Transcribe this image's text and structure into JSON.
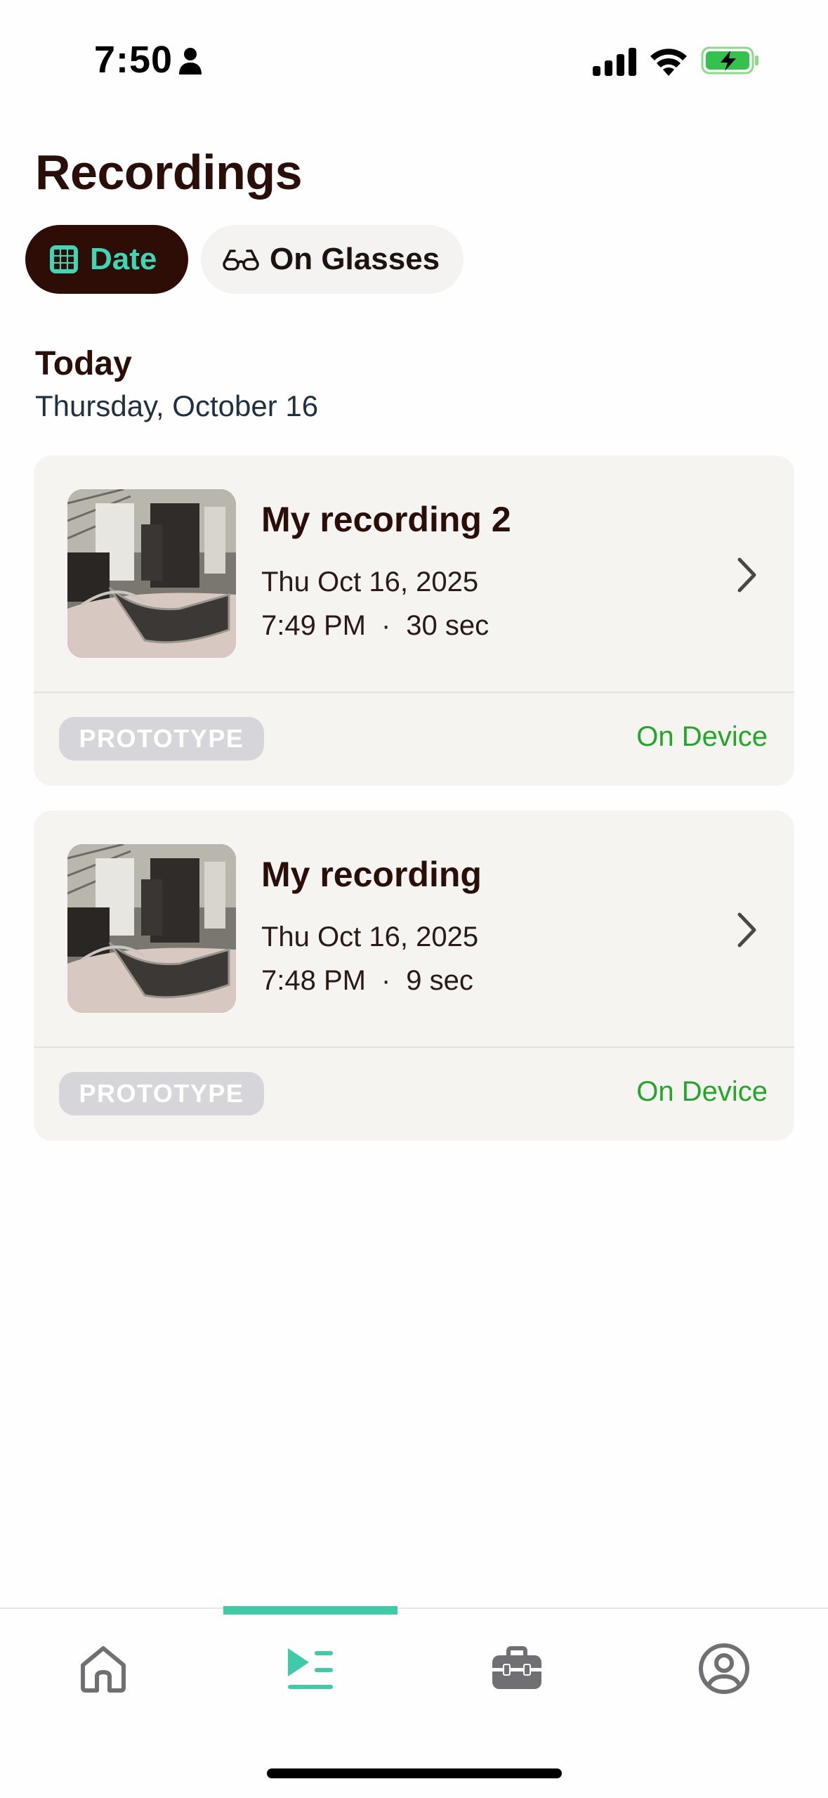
{
  "status_bar": {
    "time": "7:50",
    "icons": [
      "person-icon",
      "cellular-signal-icon",
      "wifi-icon",
      "battery-charging-icon"
    ]
  },
  "page": {
    "title": "Recordings"
  },
  "filters": [
    {
      "label": "Date",
      "icon": "calendar-grid-icon",
      "selected": true
    },
    {
      "label": "On Glasses",
      "icon": "glasses-icon",
      "selected": false
    }
  ],
  "section": {
    "heading": "Today",
    "date": "Thursday, October 16"
  },
  "recordings": [
    {
      "title": "My recording 2",
      "date": "Thu Oct 16, 2025",
      "time": "7:49 PM",
      "separator": "·",
      "duration": "30 sec",
      "badge": "PROTOTYPE",
      "storage": "On Device"
    },
    {
      "title": "My recording",
      "date": "Thu Oct 16, 2025",
      "time": "7:48 PM",
      "separator": "·",
      "duration": "9 sec",
      "badge": "PROTOTYPE",
      "storage": "On Device"
    }
  ],
  "tab_bar": {
    "tabs": [
      {
        "name": "home",
        "icon": "home-icon",
        "selected": false
      },
      {
        "name": "recordings",
        "icon": "play-list-icon",
        "selected": true
      },
      {
        "name": "toolbox",
        "icon": "toolbox-icon",
        "selected": false
      },
      {
        "name": "profile",
        "icon": "profile-icon",
        "selected": false
      }
    ]
  },
  "colors": {
    "accent": "#3fcaa8",
    "title": "#2a0e08",
    "chip_selected_bg": "#2e0d06",
    "on_device_green": "#23a62a",
    "card_bg": "#f5f4f1",
    "badge_bg": "#d6d6da"
  }
}
